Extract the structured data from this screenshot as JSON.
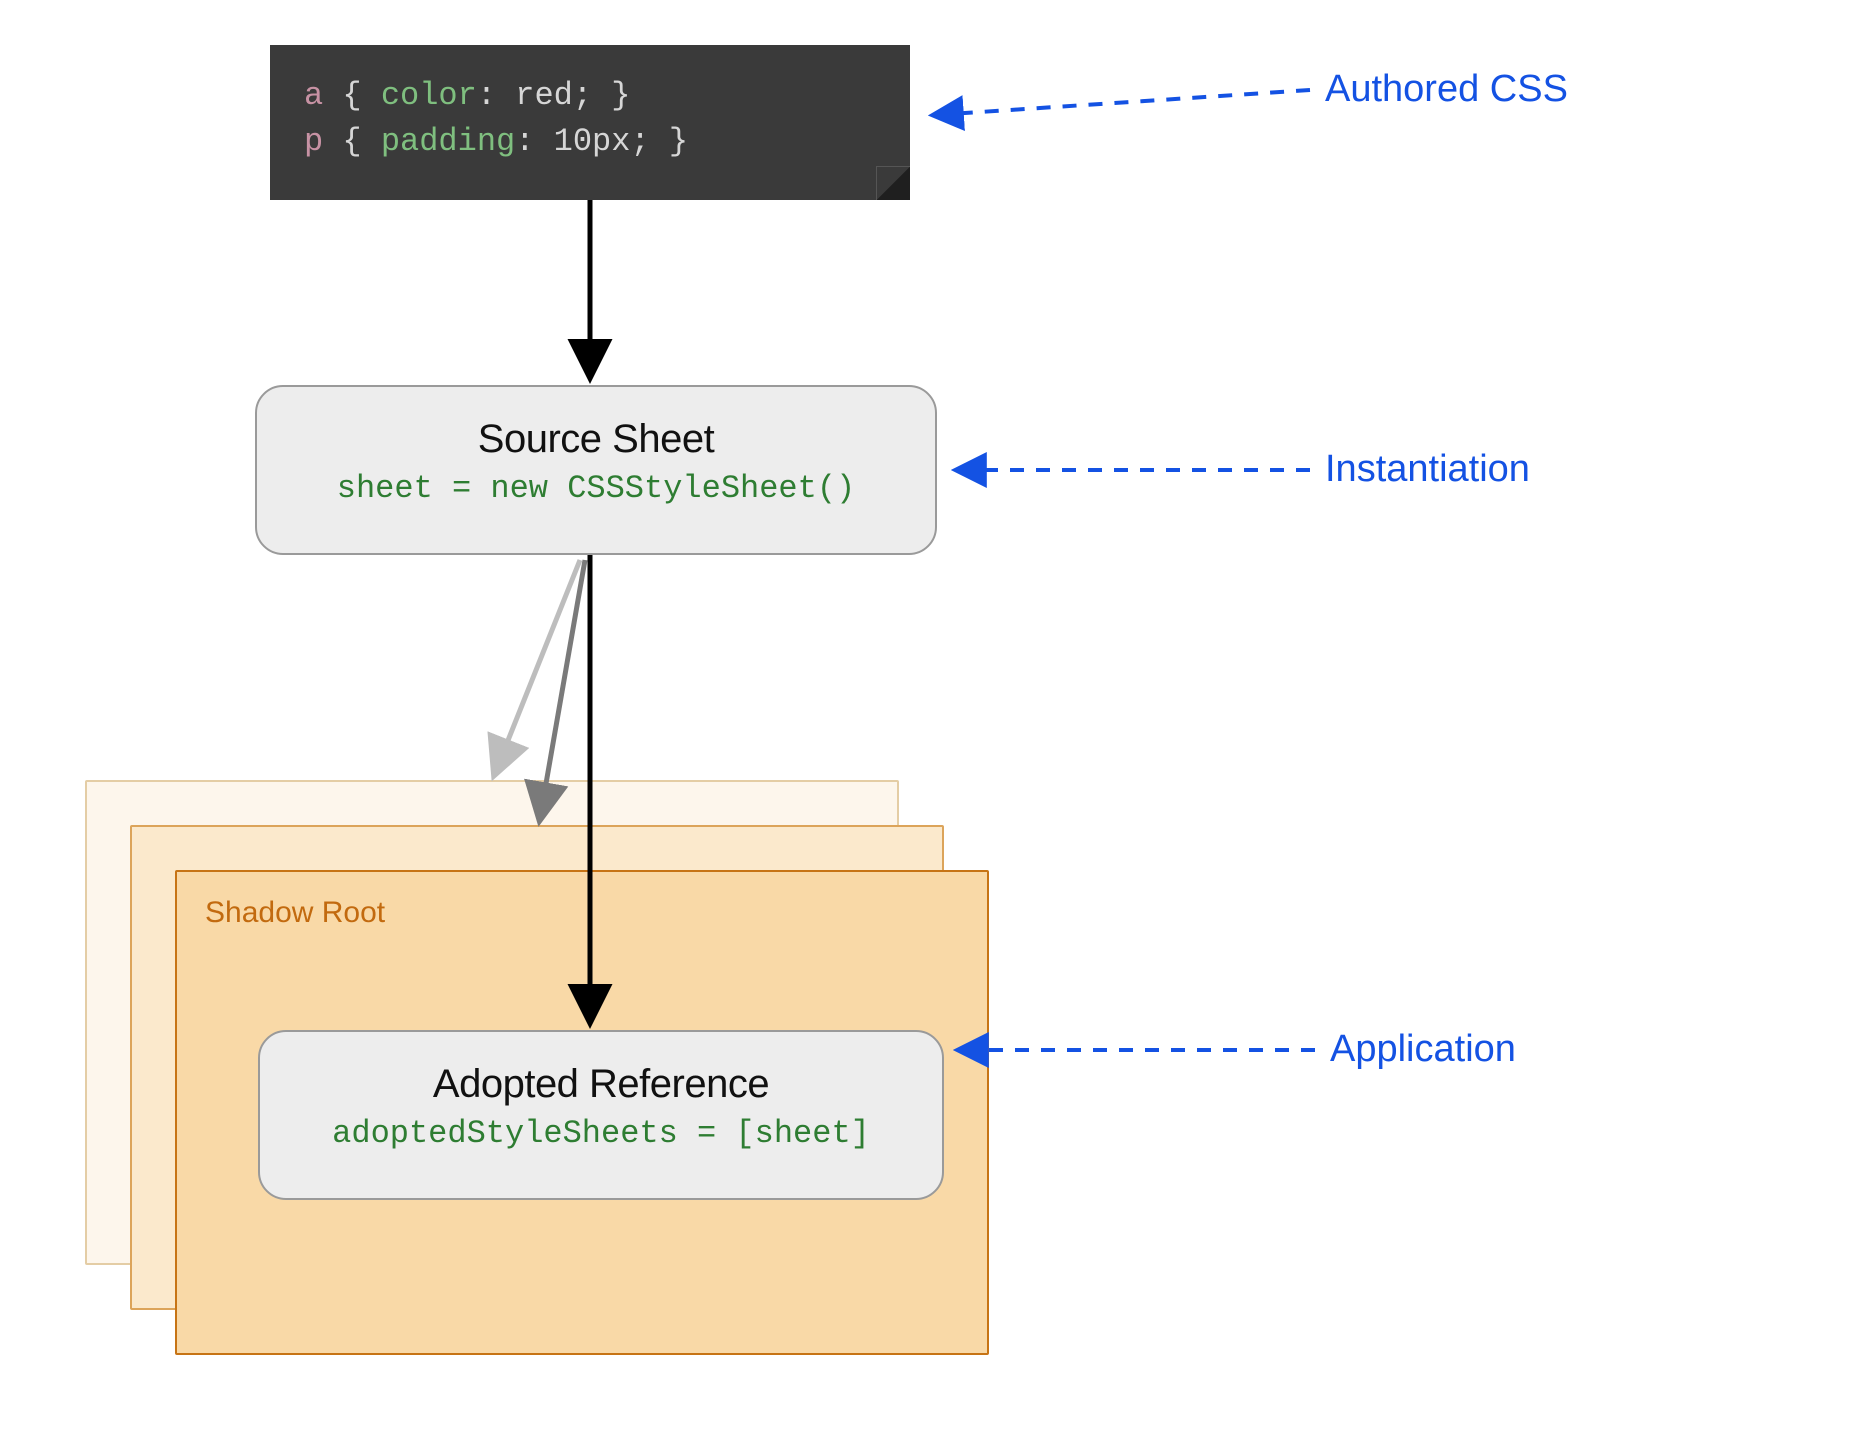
{
  "code": {
    "line1": {
      "selector": "a",
      "open": "{",
      "property": "color",
      "colon": ":",
      "value": "red",
      "semi": ";",
      "close": "}"
    },
    "line2": {
      "selector": "p",
      "open": "{",
      "property": "padding",
      "colon": ":",
      "value": "10px",
      "semi": ";",
      "close": "}"
    }
  },
  "source_sheet": {
    "title": "Source Sheet",
    "code": "sheet = new CSSStyleSheet()"
  },
  "shadow_root": {
    "label": "Shadow Root"
  },
  "adopted_ref": {
    "title": "Adopted Reference",
    "code": "adoptedStyleSheets = [sheet]"
  },
  "annotations": {
    "authored_css": "Authored CSS",
    "instantiation": "Instantiation",
    "application": "Application"
  }
}
